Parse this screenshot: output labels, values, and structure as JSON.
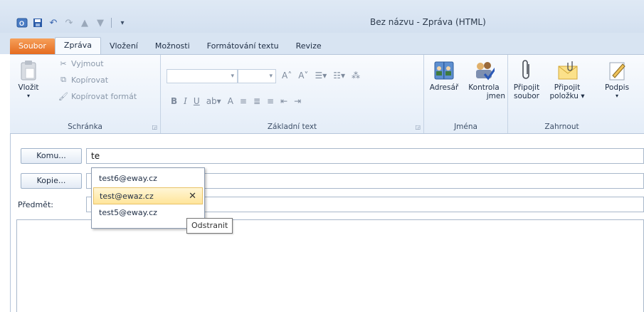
{
  "window": {
    "title": "Bez názvu - Zpráva (HTML)"
  },
  "qat": {
    "icons": [
      "outlook-icon",
      "save-icon",
      "undo-icon",
      "redo-icon",
      "up-arrow-icon",
      "down-arrow-icon",
      "customize-icon"
    ]
  },
  "tabs": [
    {
      "label": "Soubor"
    },
    {
      "label": "Zpráva"
    },
    {
      "label": "Vložení"
    },
    {
      "label": "Možnosti"
    },
    {
      "label": "Formátování textu"
    },
    {
      "label": "Revize"
    }
  ],
  "clipboard": {
    "paste": "Vložit",
    "cut": "Vyjmout",
    "copy": "Kopírovat",
    "format_painter": "Kopírovat formát",
    "group": "Schránka"
  },
  "basic_text": {
    "group": "Základní text",
    "bold": "B",
    "italic": "I",
    "underline": "U",
    "font_color": "A"
  },
  "names": {
    "address_book": "Adresář",
    "check_names_1": "Kontrola",
    "check_names_2": "jmen",
    "group": "Jména"
  },
  "include": {
    "attach_file_1": "Připojit",
    "attach_file_2": "soubor",
    "attach_item_1": "Připojit",
    "attach_item_2": "položku ▾",
    "signature": "Podpis",
    "group": "Zahrnout"
  },
  "compose": {
    "to_label": "Komu...",
    "to_value": "te",
    "cc_label": "Kopie...",
    "subject_label": "Předmět:"
  },
  "autocomplete": {
    "items": [
      "test6@eway.cz",
      "test@ewaz.cz",
      "test5@eway.cz"
    ],
    "remove_tooltip": "Odstranit"
  },
  "colors": {
    "file_tab": "#e56b1f",
    "highlight": "#ffe59a"
  }
}
